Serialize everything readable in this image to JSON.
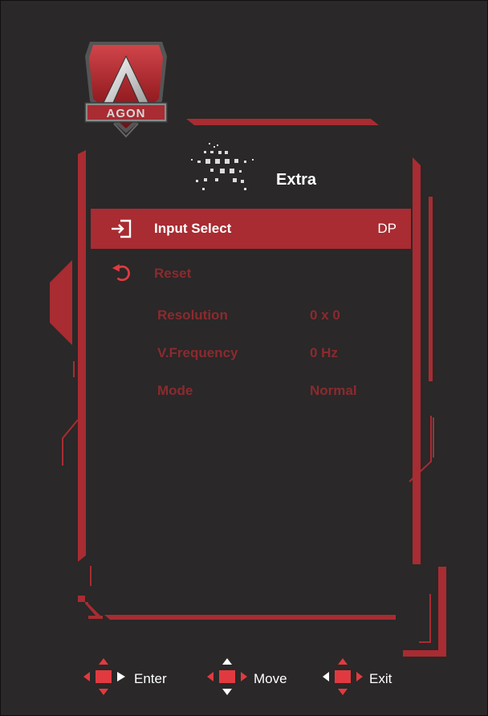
{
  "logo": {
    "text": "AGON"
  },
  "header": {
    "title": "Extra",
    "icon": "star-icon"
  },
  "menu": {
    "items": [
      {
        "label": "Input Select",
        "value": "DP",
        "icon": "input-icon",
        "selected": true
      },
      {
        "label": "Reset",
        "value": "",
        "icon": "reset-icon",
        "selected": false
      }
    ]
  },
  "info": [
    {
      "label": "Resolution",
      "value": "0 x 0"
    },
    {
      "label": "V.Frequency",
      "value": "0 Hz"
    },
    {
      "label": "Mode",
      "value": "Normal"
    }
  ],
  "footer": {
    "hints": [
      {
        "label": "Enter",
        "icon": "dpad-enter-icon"
      },
      {
        "label": "Move",
        "icon": "dpad-move-icon"
      },
      {
        "label": "Exit",
        "icon": "dpad-exit-icon"
      }
    ]
  },
  "colors": {
    "background": "#2a2828",
    "accent": "#a82c32",
    "dim_text": "#8b2a2f",
    "text": "#ffffff"
  }
}
